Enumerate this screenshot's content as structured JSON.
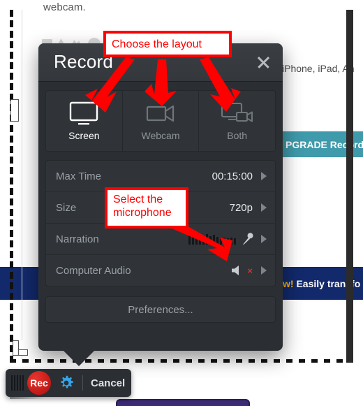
{
  "background": {
    "text_top": "webcam.",
    "text_right": "iPhone, iPad, An",
    "upgrade_banner": "PGRADE Record",
    "promo_prefix": "w!",
    "promo_text": " Easily transfo"
  },
  "dialog": {
    "title": "Record",
    "close_icon": "close-icon",
    "layout": {
      "options": [
        {
          "label": "Screen",
          "icon": "monitor-icon",
          "selected": true
        },
        {
          "label": "Webcam",
          "icon": "video-camera-icon",
          "selected": false
        },
        {
          "label": "Both",
          "icon": "monitor-camera-icon",
          "selected": false
        }
      ]
    },
    "settings": [
      {
        "name": "Max Time",
        "value": "00:15:00",
        "icon": "",
        "chevron": "chevron-right-icon"
      },
      {
        "name": "Size",
        "value": "720p",
        "icon": "",
        "chevron": "chevron-right-icon"
      },
      {
        "name": "Narration",
        "value": "",
        "icon": "microphone-icon",
        "chevron": "chevron-right-icon"
      },
      {
        "name": "Computer Audio",
        "value": "",
        "icon": "speaker-muted-icon",
        "chevron": "chevron-right-icon"
      }
    ],
    "preferences_label": "Preferences..."
  },
  "rec_bar": {
    "record_label": "Rec",
    "settings_icon": "gear-icon",
    "cancel_label": "Cancel"
  },
  "annotations": [
    {
      "id": "callout-layout",
      "text": "Choose the layout"
    },
    {
      "id": "callout-mic",
      "text": "Select the microphone"
    }
  ],
  "colors": {
    "annotation_red": "#ff0000",
    "dialog_bg": "#2b2f33",
    "record_red": "#b20d0d",
    "gear_blue": "#35a5e8",
    "banner_teal": "#3f9aab",
    "promo_blue": "#12296b",
    "promo_accent": "#f5b400"
  }
}
